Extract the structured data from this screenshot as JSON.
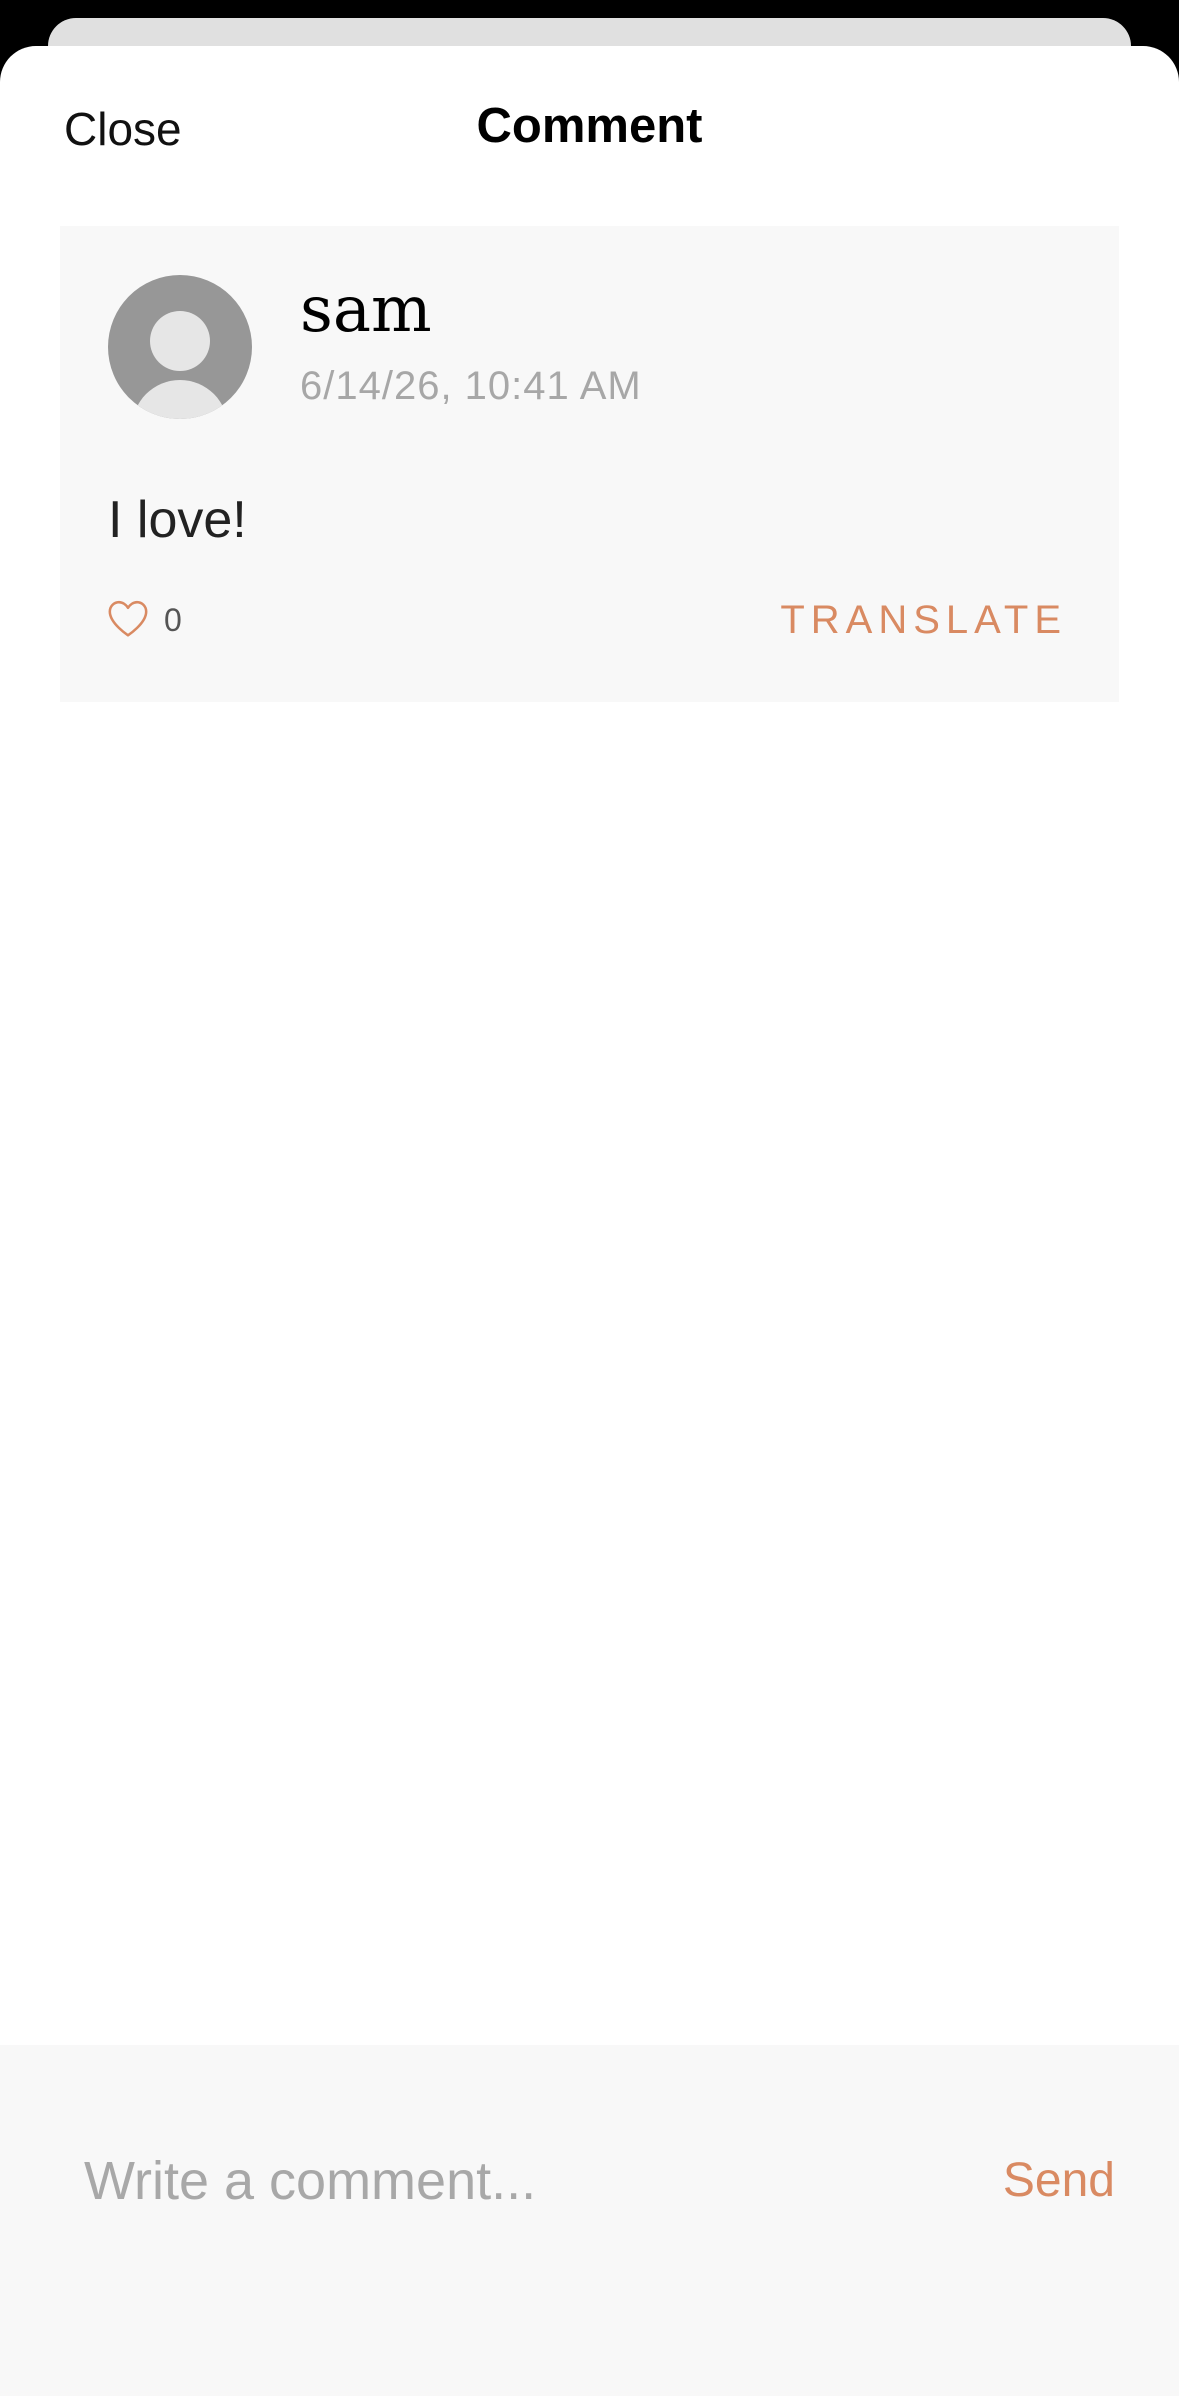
{
  "header": {
    "close_label": "Close",
    "title": "Comment"
  },
  "comment": {
    "author": "sam",
    "timestamp": "6/14/26, 10:41 AM",
    "text": "I love!",
    "like_count": "0",
    "translate_label": "TRANSLATE",
    "avatar_icon": "default-user-icon",
    "like_icon": "heart-outline-icon"
  },
  "composer": {
    "placeholder": "Write a comment...",
    "value": "",
    "send_label": "Send"
  },
  "colors": {
    "accent": "#d98a62",
    "card_background": "#f8f8f8",
    "muted_text": "#a7a7a7"
  }
}
